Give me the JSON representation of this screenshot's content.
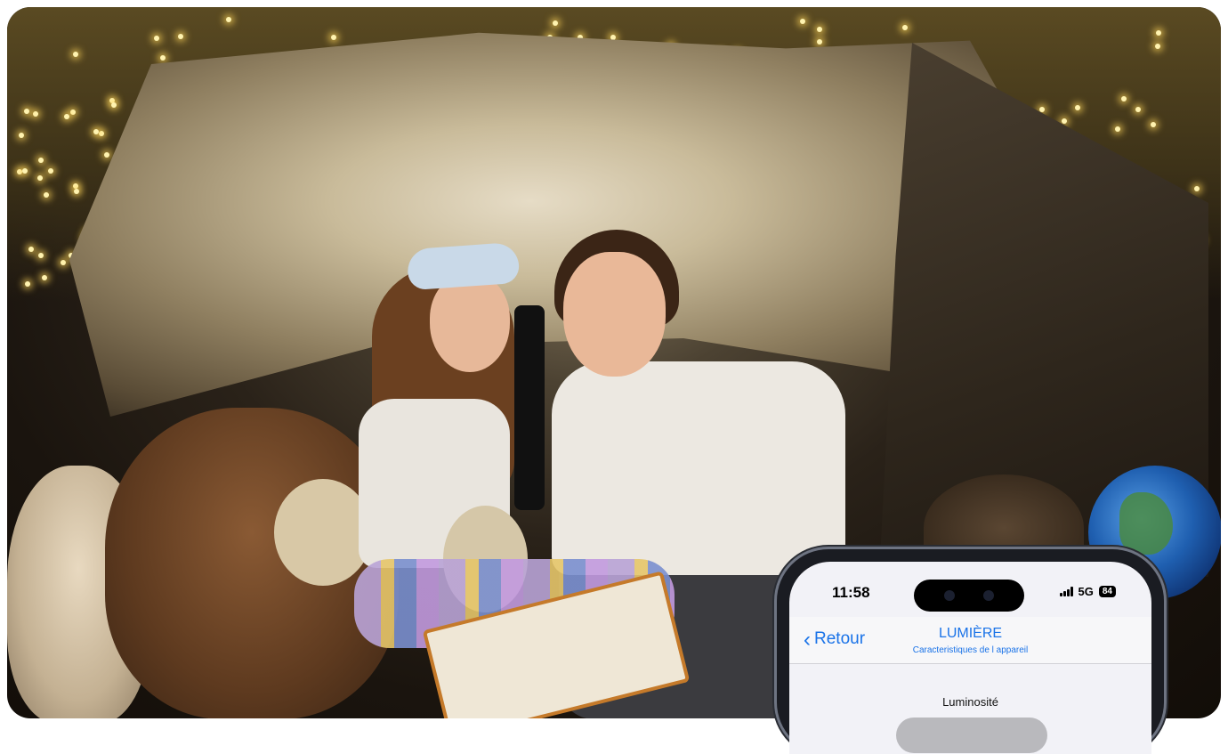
{
  "phone": {
    "status_time": "11:58",
    "network": "5G",
    "battery": "84",
    "back_label": "Retour",
    "title": "LUMIÈRE",
    "subtitle": "Caracteristiques de l appareil",
    "brightness_label": "Luminosité"
  }
}
